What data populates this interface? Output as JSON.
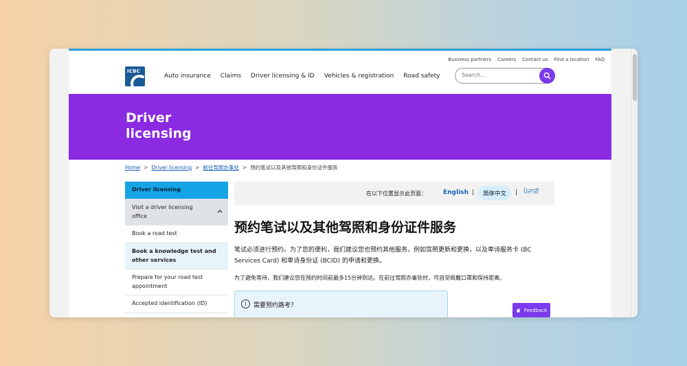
{
  "utility_links": [
    "Business partners",
    "Careers",
    "Contact us",
    "Find a location",
    "FAQ"
  ],
  "logo": {
    "text": "ICBC",
    "icon": "icbc-logo"
  },
  "nav": [
    "Auto insurance",
    "Claims",
    "Driver licensing & ID",
    "Vehicles & registration",
    "Road safety"
  ],
  "search": {
    "placeholder": "Search...",
    "icon": "search-icon"
  },
  "hero": {
    "title": "Driver licensing"
  },
  "breadcrumb": {
    "items": [
      "Home",
      "Driver licensing",
      "前往驾照办事处",
      "预约笔试以及其他驾照和身份证件服务"
    ],
    "separator": ">"
  },
  "sidenav": [
    "Driver licensing",
    "Visit a driver licensing office",
    "Book a road test",
    "Book a knowledge test and other services",
    "Prepare for your road test appointment",
    "Accepted identification (ID)"
  ],
  "language": {
    "prompt": "在以下位置显示此页面：",
    "english": "English",
    "chinese": "简体中文",
    "punjabi": "ਪੰਜਾਬੀ",
    "divider": "|"
  },
  "content": {
    "title": "预约笔试以及其他驾照和身份证件服务",
    "para1": "笔试必须进行预约。为了您的便利，我们建议您也预约其他服务，例如驾照更新和更换，以及卑诗服务卡 (BC Services Card) 和卑诗身份证 (BCID) 的申请和更换。",
    "para2": "为了避免等待，我们建议您在预约时间前最多15分钟到达。在前往驾照办事处时，可自觉佩戴口罩和保持距离。",
    "info_title": "需要预约路考？",
    "info_icon_glyph": "i"
  },
  "feedback": {
    "label": "Feedback",
    "icon": "megaphone-icon"
  },
  "colors": {
    "brand_purple": "#8a2be2",
    "accent_blue": "#15a5e6",
    "link_blue": "#1a5fb4"
  }
}
